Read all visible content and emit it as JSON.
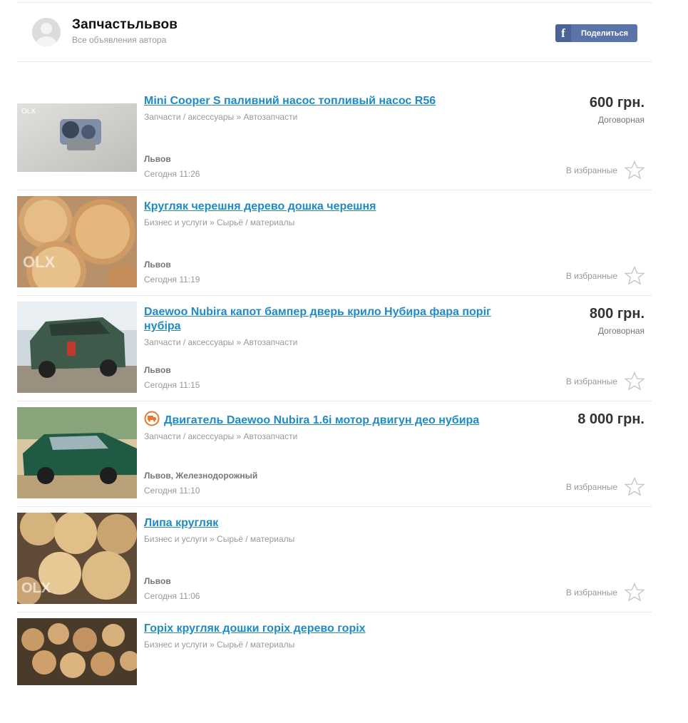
{
  "seller": {
    "name": "Запчастьльвов",
    "subtitle": "Все объявления автора"
  },
  "share": {
    "label": "Поделиться",
    "icon": "facebook-icon"
  },
  "favorite_label": "В избранные",
  "ads": [
    {
      "title": "Mini Cooper S паливний насос топливый насос R56",
      "category": "Запчасти / аксессуары » Автозапчасти",
      "price": "600 грн.",
      "price_note": "Договорная",
      "location": "Львов",
      "time": "Сегодня 11:26"
    },
    {
      "title": "Кругляк черешня дерево дошка черешня",
      "category": "Бизнес и услуги » Сырьё / материалы",
      "price": "",
      "price_note": "",
      "location": "Львов",
      "time": "Сегодня 11:19"
    },
    {
      "title": "Daewoo Nubira капот бампер дверь крило Нубира фара поріг нубіра",
      "category": "Запчасти / аксессуары » Автозапчасти",
      "price": "800 грн.",
      "price_note": "Договорная",
      "location": "Львов",
      "time": "Сегодня 11:15"
    },
    {
      "title": "Двигатель Daewoo Nubira 1.6i мотор двигун део нубира",
      "category": "Запчасти / аксессуары » Автозапчасти",
      "price": "8 000 грн.",
      "price_note": "",
      "location": "Львов, Железнодорожный",
      "time": "Сегодня 11:10",
      "delivery_icon": "delivery-check-icon"
    },
    {
      "title": "Липа кругляк",
      "category": "Бизнес и услуги » Сырьё / материалы",
      "price": "",
      "price_note": "",
      "location": "Львов",
      "time": "Сегодня 11:06"
    },
    {
      "title": "Горіх кругляк дошки горіх дерево горіх",
      "category": "Бизнес и услуги » Сырьё / материалы",
      "price": "",
      "price_note": "",
      "location": "",
      "time": ""
    }
  ],
  "colors": {
    "link": "#1f8ac3",
    "facebook": "#5a74a8",
    "delivery": "#e8782c"
  }
}
